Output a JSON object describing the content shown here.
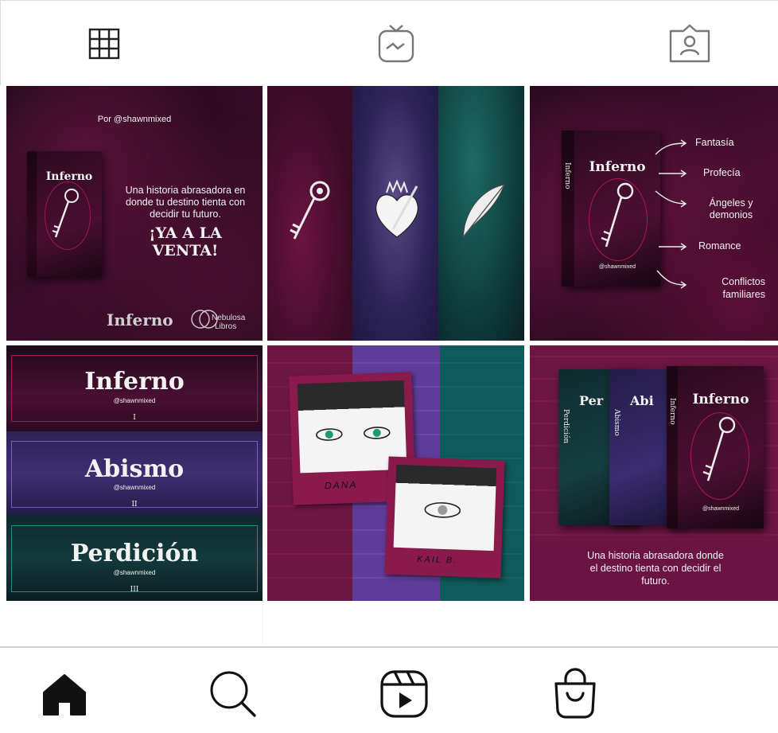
{
  "tabs": [
    {
      "icon": "grid-icon"
    },
    {
      "icon": "igtv-icon"
    },
    {
      "icon": "tagged-icon"
    }
  ],
  "posts": {
    "p1": {
      "byline": "Por @shawnmixed",
      "book_title": "Inferno",
      "tagline": "Una historia abrasadora en donde tu destino tienta con decidir tu futuro.",
      "cta": "¡YA A LA VENTA!",
      "footer_title": "Inferno",
      "publisher_line1": "Nebulosa",
      "publisher_line2": "Libros"
    },
    "p2": {
      "icons": [
        "key-icon",
        "heart-dagger-icon",
        "feather-icon"
      ]
    },
    "p3": {
      "book_title": "Inferno",
      "spine": "Inferno",
      "author": "@shawnmixed",
      "topics": [
        "Fantasía",
        "Profecía",
        "Ángeles y demonios",
        "Romance",
        "Conflictos familiares"
      ]
    },
    "p4": {
      "banners": [
        {
          "title": "Inferno",
          "author": "@shawnmixed",
          "numeral": "I"
        },
        {
          "title": "Abismo",
          "author": "@shawnmixed",
          "numeral": "II"
        },
        {
          "title": "Perdición",
          "author": "@shawnmixed",
          "numeral": "III"
        }
      ]
    },
    "p5": {
      "caption1": "DANA",
      "caption2": "KAIL B."
    },
    "p6": {
      "books": [
        "Perdición",
        "Abismo",
        "Inferno"
      ],
      "book_fronts": [
        "Per",
        "Abi",
        "Inferno"
      ],
      "author": "@shawnmixed",
      "tagline": "Una historia abrasadora donde el destino tienta con decidir el futuro."
    }
  },
  "bottom_nav": [
    {
      "icon": "home-icon",
      "active": true
    },
    {
      "icon": "search-icon"
    },
    {
      "icon": "reels-icon"
    },
    {
      "icon": "shop-icon"
    }
  ],
  "colors": {
    "magenta": "#6b0f3e",
    "purple": "#3d2a6b",
    "teal": "#0e5a5a",
    "dark": "#15101c"
  }
}
